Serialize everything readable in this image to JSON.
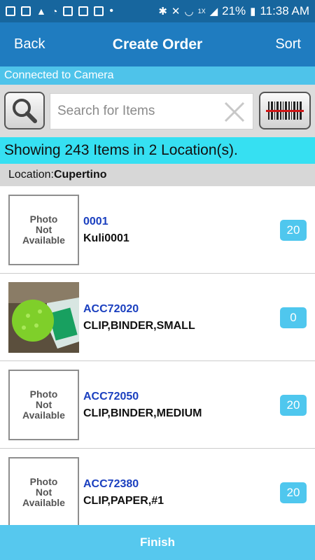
{
  "status_bar": {
    "signal_badge": "1X",
    "battery_percent": "21%",
    "time": "11:38 AM"
  },
  "nav": {
    "back_label": "Back",
    "title": "Create Order",
    "sort_label": "Sort"
  },
  "camera_status": "Connected to Camera",
  "search": {
    "placeholder": "Search for Items"
  },
  "showing_text": "Showing 243 Items in 2 Location(s).",
  "location": {
    "prefix": "Location:",
    "name": "Cupertino"
  },
  "placeholder_photo": {
    "line1": "Photo",
    "line2": "Not",
    "line3": "Available"
  },
  "items": [
    {
      "code": "0001",
      "description": "Kuli0001",
      "qty": "20"
    },
    {
      "code": "ACC72020",
      "description": "CLIP,BINDER,SMALL",
      "qty": "0"
    },
    {
      "code": "ACC72050",
      "description": "CLIP,BINDER,MEDIUM",
      "qty": "20"
    },
    {
      "code": "ACC72380",
      "description": "CLIP,PAPER,#1",
      "qty": "20"
    }
  ],
  "finish_label": "Finish",
  "colors": {
    "status_bar": "#17669e",
    "nav_bar": "#1f7cc0",
    "camera_bar": "#4ec3ea",
    "showing_bar": "#36e0f2",
    "qty_badge": "#4fc7ee",
    "item_code": "#1a3fbf",
    "finish_bar": "#56c8ee"
  },
  "icons": [
    "search-icon",
    "clear-icon",
    "barcode-scan-icon"
  ]
}
